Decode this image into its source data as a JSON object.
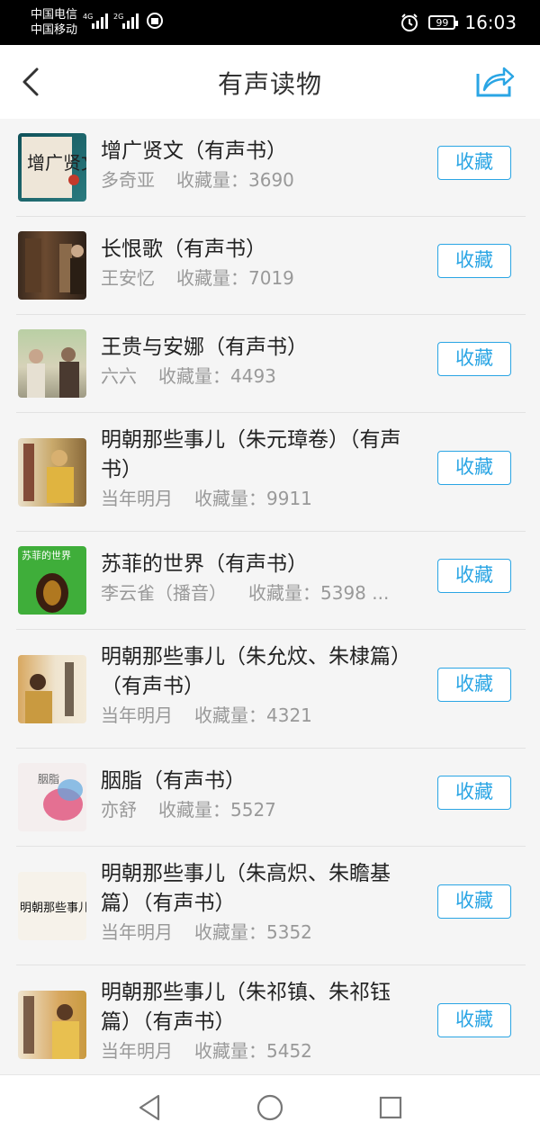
{
  "status": {
    "carrier1": "中国电信",
    "carrier2": "中国移动",
    "net1": "4G",
    "net2": "2G",
    "battery": "99",
    "time": "16:03"
  },
  "header": {
    "title": "有声读物",
    "back_icon": "chevron-left-icon",
    "share_icon": "share-icon"
  },
  "list": {
    "collect_label": "收藏",
    "count_prefix": "收藏量：",
    "items": [
      {
        "title": "增广贤文（有声书）",
        "author": "多奇亚",
        "count": "3690"
      },
      {
        "title": "长恨歌（有声书）",
        "author": "王安忆",
        "count": "7019"
      },
      {
        "title": "王贵与安娜（有声书）",
        "author": "六六",
        "count": "4493"
      },
      {
        "title": "明朝那些事儿（朱元璋卷）（有声书）",
        "author": "当年明月",
        "count": "9911"
      },
      {
        "title": "苏菲的世界（有声书）",
        "author": "李云雀（播音）",
        "count": "5398 ..."
      },
      {
        "title": "明朝那些事儿（朱允炆、朱棣篇）（有声书）",
        "author": "当年明月",
        "count": "4321"
      },
      {
        "title": "胭脂（有声书）",
        "author": "亦舒",
        "count": "5527"
      },
      {
        "title": "明朝那些事儿（朱高炽、朱瞻基篇）（有声书）",
        "author": "当年明月",
        "count": "5352"
      },
      {
        "title": "明朝那些事儿（朱祁镇、朱祁钰篇）（有声书）",
        "author": "当年明月",
        "count": "5452"
      }
    ]
  },
  "covers": {
    "c0_text": "增广贤文",
    "c4_text": "苏菲的世界",
    "c6_text": "胭脂",
    "c7_text": "明朝那些事儿"
  },
  "nav": {
    "back_icon": "triangle-back-icon",
    "home_icon": "circle-home-icon",
    "recent_icon": "square-recent-icon"
  },
  "colors": {
    "accent": "#2aa5e4",
    "meta": "#999999",
    "title": "#222222"
  }
}
